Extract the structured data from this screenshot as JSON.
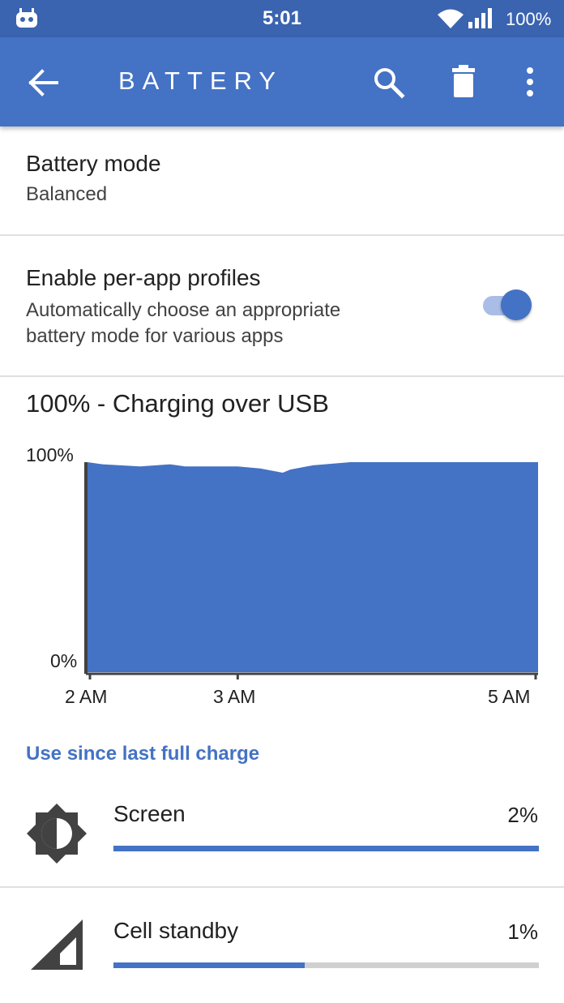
{
  "status_bar": {
    "time": "5:01",
    "battery": "100%",
    "icons": [
      "cyanogen-icon",
      "wifi-icon",
      "cell-signal-icon"
    ]
  },
  "app_bar": {
    "title": "BATTERY",
    "icons": [
      "back-arrow-icon",
      "search-icon",
      "trash-icon",
      "more-vert-icon"
    ],
    "color": "#4472c4"
  },
  "battery_mode": {
    "title": "Battery mode",
    "value": "Balanced"
  },
  "per_app_profiles": {
    "title": "Enable per-app profiles",
    "summary_line1": "Automatically choose an appropriate",
    "summary_line2": "battery mode for various apps",
    "enabled": true
  },
  "charge_status": "100% - Charging over USB",
  "chart_data": {
    "type": "area",
    "y_ticks": [
      "100%",
      "0%"
    ],
    "x_ticks": [
      "2 AM",
      "3 AM",
      "5 AM"
    ],
    "ylim": [
      0,
      100
    ],
    "xlim": [
      2.0,
      5.0
    ],
    "x": [
      2.0,
      2.1,
      2.35,
      2.55,
      2.65,
      3.0,
      3.15,
      3.3,
      3.35,
      3.5,
      3.75,
      4.0,
      5.0
    ],
    "values": [
      100,
      99,
      98,
      99,
      98,
      98,
      97,
      95,
      96.5,
      98.5,
      100,
      100,
      100
    ],
    "color": "#4472c4"
  },
  "usage_header": "Use since last full charge",
  "usage": [
    {
      "label": "Screen",
      "percent": "2%",
      "fraction": 1.0,
      "icon": "brightness-icon"
    },
    {
      "label": "Cell standby",
      "percent": "1%",
      "fraction": 0.45,
      "icon": "cell-signal-icon"
    }
  ]
}
